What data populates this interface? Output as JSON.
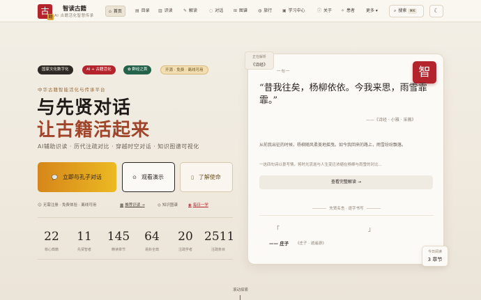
{
  "brand": {
    "logo_char": "古",
    "logo_badge": "籍",
    "title": "智读古籍",
    "subtitle": "AI 古籍活化智慧传承"
  },
  "nav": {
    "items": [
      {
        "icon": "⌂",
        "label": "首页",
        "active": true
      },
      {
        "icon": "▤",
        "label": "目录"
      },
      {
        "icon": "▥",
        "label": "识读"
      },
      {
        "icon": "✎",
        "label": "解读"
      },
      {
        "icon": "◌",
        "label": "对话"
      },
      {
        "icon": "⊞",
        "label": "图谱"
      },
      {
        "icon": "◍",
        "label": "旅行"
      },
      {
        "icon": "▣",
        "label": "学习中心"
      },
      {
        "icon": "ⓘ",
        "label": "关于"
      },
      {
        "icon": "✧",
        "label": "患者"
      },
      {
        "icon": "",
        "label": "更多 ▾"
      }
    ],
    "search_label": "搜索",
    "search_kbd": "⌘K",
    "theme_icon": "☾"
  },
  "hero": {
    "tags": [
      "国家文化数字化",
      "AI + 古籍活化",
      "✿ 群经之首",
      "开源 · 免费 · 离线可用"
    ],
    "eyebrow": "中华古籍智能活化与传承平台",
    "title_line1": "与先贤对话",
    "title_line2": "让古籍活起来",
    "subtitle": "AI辅助识读 · 历代注疏对比 · 穿越时空对话 · 知识图谱可视化",
    "btn_primary": "立即与孔子对话",
    "btn_demo": "观看演示",
    "btn_mission": "了解使命",
    "mini_links": [
      {
        "icon": "☺",
        "label": "无需注册 · 免费体验 · 离线可用",
        "style": "plain"
      },
      {
        "icon": "▦",
        "label": "推荐识读 →",
        "style": "link"
      },
      {
        "icon": "◎",
        "label": "知识图谱",
        "style": "plain"
      },
      {
        "icon": "◉",
        "label": "每日一学",
        "style": "red"
      }
    ]
  },
  "stats": [
    {
      "value": "22",
      "label": "核心典籍"
    },
    {
      "value": "11",
      "label": "先贤智者"
    },
    {
      "value": "145",
      "label": "精读章节"
    },
    {
      "value": "64",
      "label": "易卦全典"
    },
    {
      "value": "20",
      "label": "注疏学者"
    },
    {
      "value": "2511",
      "label": "注疏条目"
    }
  ],
  "card": {
    "source_tab_title": "正在解析",
    "source_tab_value": "《诗经》",
    "label": "一句一",
    "seal_char": "智",
    "poem": "“昔我往矣，杨柳依依。今我来思，雨雪霏霏。”",
    "citation": "——《诗经 · 小雅 · 采薇》",
    "interp": "从前我出征的时候，杨柳随风柔美地摇曳。如今我回来的路上，雨雪纷纷飘落。",
    "interp2": "一这四句诗以景写情，将时光流逝与人生变迁浓缩在杨柳与雨雪的对比...",
    "full_btn": "查看完整解读 →",
    "quote_label": "先贤名言 · 逐字书写",
    "bracket_left": "「",
    "bracket_right": "」",
    "author": "—— 庄子",
    "author_src": "《庄子 · 逍遥游》"
  },
  "today": {
    "title": "今日阅读",
    "value": "3 章节"
  },
  "scroll_hint": "滚动探索"
}
